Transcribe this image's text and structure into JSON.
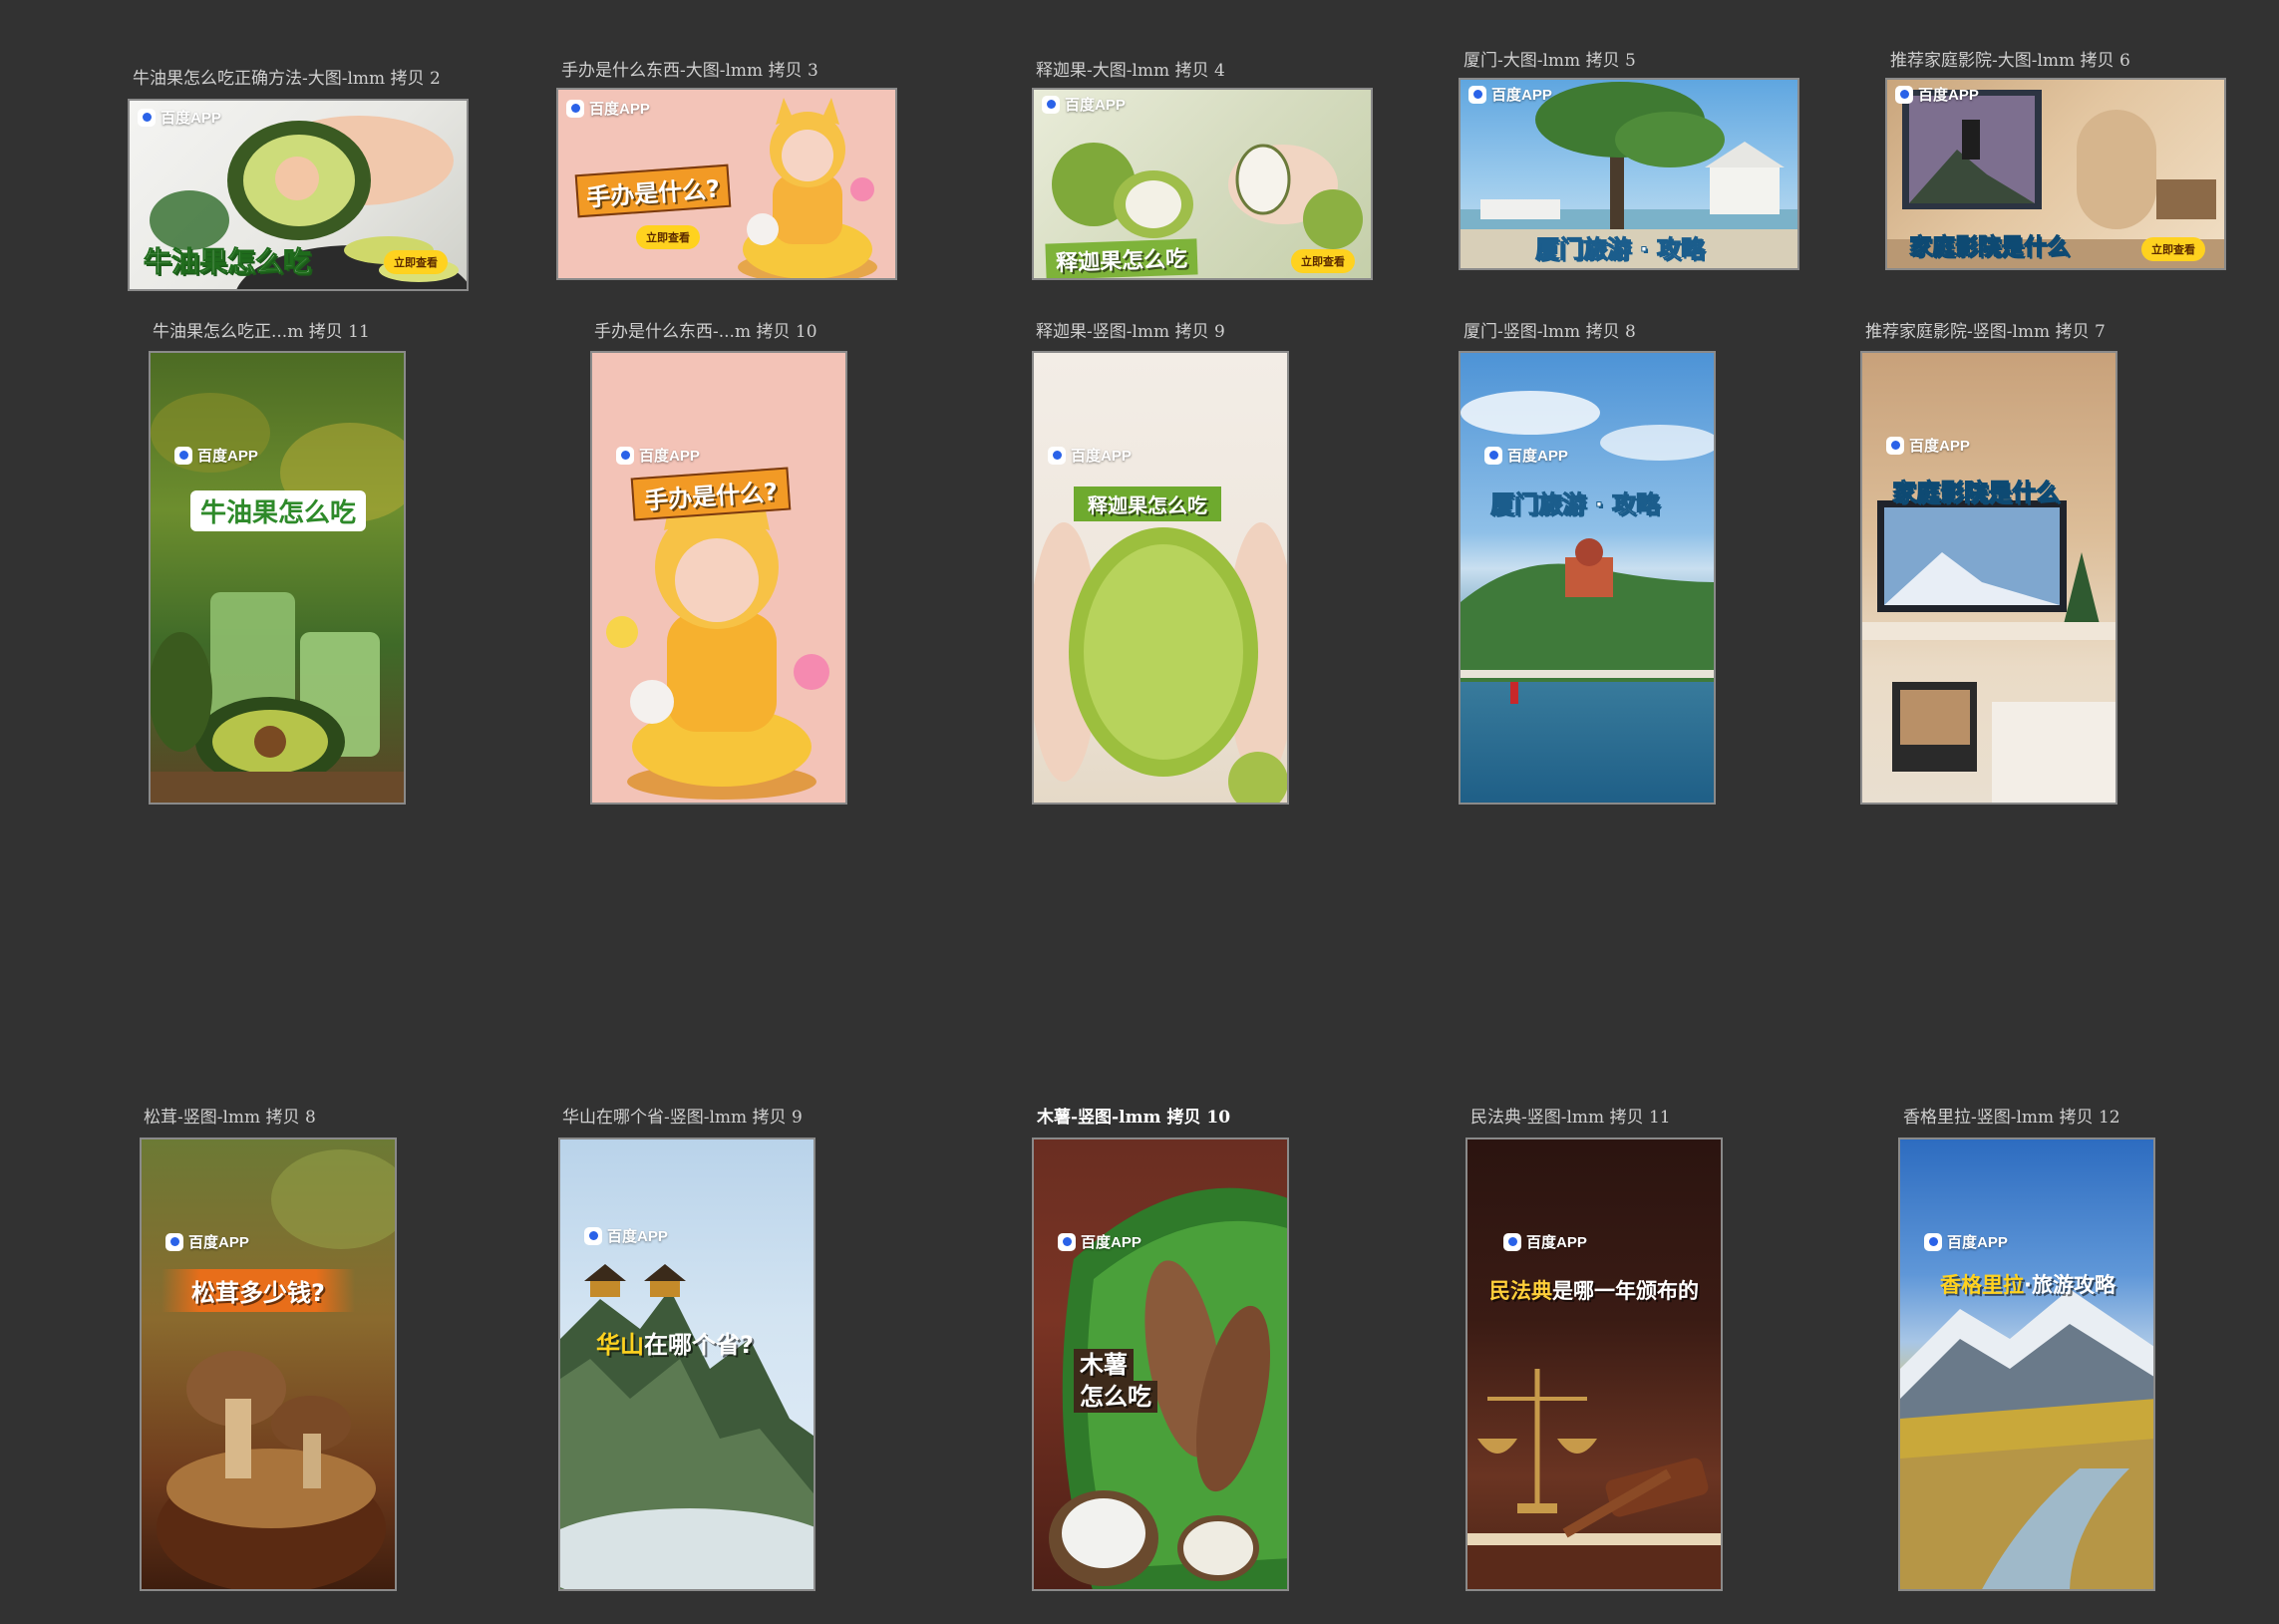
{
  "brand": {
    "logo_text": "百度APP",
    "accent": "#2a62e8",
    "cta_color": "#ffd21f"
  },
  "row1": [
    {
      "label": "牛油果怎么吃正确方法-大图-lmm 拷贝 2",
      "headline": "牛油果怎么吃",
      "cta": "立即查看"
    },
    {
      "label": "手办是什么东西-大图-lmm 拷贝 3",
      "headline": "手办是什么?",
      "cta": "立即查看"
    },
    {
      "label": "释迦果-大图-lmm 拷贝 4",
      "headline": "释迦果怎么吃",
      "cta": "立即查看"
    },
    {
      "label": "厦门-大图-lmm 拷贝 5",
      "headline": "厦门旅游 · 攻略"
    },
    {
      "label": "推荐家庭影院-大图-lmm 拷贝 6",
      "headline": "家庭影院是什么",
      "cta": "立即查看"
    }
  ],
  "row2": [
    {
      "label": "牛油果怎么吃正...m 拷贝 11",
      "headline": "牛油果怎么吃"
    },
    {
      "label": "手办是什么东西-...m 拷贝 10",
      "headline": "手办是什么?"
    },
    {
      "label": "释迦果-竖图-lmm 拷贝 9",
      "headline": "释迦果怎么吃"
    },
    {
      "label": "厦门-竖图-lmm 拷贝 8",
      "headline": "厦门旅游 · 攻略"
    },
    {
      "label": "推荐家庭影院-竖图-lmm 拷贝 7",
      "headline": "家庭影院是什么"
    }
  ],
  "row3": [
    {
      "label": "松茸-竖图-lmm 拷贝 8",
      "headline": "松茸多少钱?"
    },
    {
      "label": "华山在哪个省-竖图-lmm 拷贝 9",
      "headline_a": "华山",
      "headline_b": "在哪个省?"
    },
    {
      "label": "木薯-竖图-lmm 拷贝 10",
      "headline_a": "木薯",
      "headline_b": "怎么吃",
      "selected": true
    },
    {
      "label": "民法典-竖图-lmm 拷贝 11",
      "headline_a": "民法典",
      "headline_b": "是哪一年颁布的"
    },
    {
      "label": "香格里拉-竖图-lmm 拷贝 12",
      "headline_a": "香格里拉",
      "headline_b": "·旅游攻略"
    }
  ]
}
